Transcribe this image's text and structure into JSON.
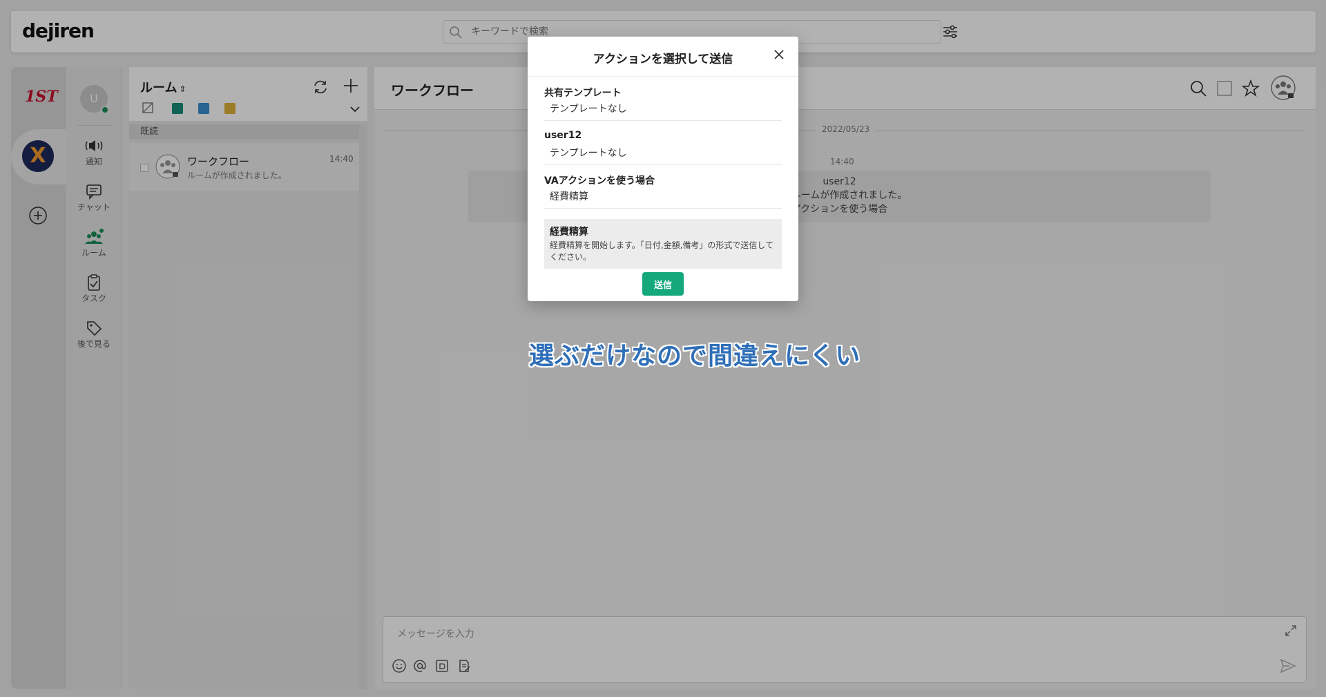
{
  "app": {
    "logo": "dejiren",
    "search_placeholder": "キーワードで検索"
  },
  "workspaces": {
    "first_label": "1ST",
    "active_label": "X"
  },
  "nav": {
    "avatar_initial": "U",
    "items": [
      {
        "label": "通知",
        "icon": "notification-icon"
      },
      {
        "label": "チャット",
        "icon": "chat-icon"
      },
      {
        "label": "ルーム",
        "icon": "room-icon"
      },
      {
        "label": "タスク",
        "icon": "task-icon"
      },
      {
        "label": "後で見る",
        "icon": "tag-icon"
      }
    ]
  },
  "rooms": {
    "title": "ルーム",
    "sort_icon": "⇕",
    "tag_colors": [
      "#1a8f7a",
      "#3a8fd0",
      "#e0b23a"
    ],
    "section": "既読",
    "items": [
      {
        "name": "ワークフロー",
        "time": "14:40",
        "preview": "ルームが作成されました。"
      }
    ]
  },
  "chat": {
    "title": "ワークフロー",
    "date": "2022/05/23",
    "time": "14:40",
    "message_user": "user12",
    "message_line1": "ットルームが作成されました。",
    "message_line2": "アクションを使う場合",
    "composer_placeholder": "メッセージを入力"
  },
  "modal": {
    "title": "アクションを選択して送信",
    "groups": [
      {
        "label": "共有テンプレート",
        "option": "テンプレートなし"
      },
      {
        "label": "user12",
        "option": "テンプレートなし"
      },
      {
        "label": "VAアクションを使う場合",
        "option": "経費精算"
      }
    ],
    "description": {
      "title": "経費精算",
      "text": "経費精算を開始します。「日付,金額,備考」の形式で送信してください。"
    },
    "send_label": "送信"
  },
  "caption": "選ぶだけなので間違えにくい",
  "colors": {
    "accent": "#14a87a",
    "caption": "#2f6fb8",
    "status_online": "#1a8f5a"
  }
}
